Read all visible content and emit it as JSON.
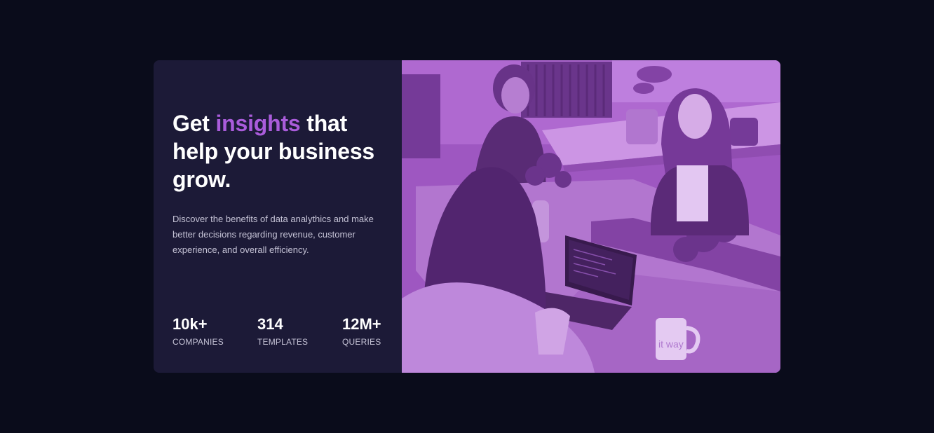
{
  "hero": {
    "title_before": "Get",
    "title_accent": "insights",
    "title_after": "that help your business grow.",
    "description": "Discover the benefits of data analythics and make better decisions regarding revenue, customer experience, and overall efficiency."
  },
  "stats": [
    {
      "value": "10k+",
      "label": "COMPANIES"
    },
    {
      "value": "314",
      "label": "TEMPLATES"
    },
    {
      "value": "12M+",
      "label": "QUERIES"
    }
  ],
  "image": {
    "mug_text": "it way"
  },
  "colors": {
    "page_background": "#0a0c1b",
    "card_background": "#1c1a37",
    "accent": "#aa5cdb",
    "image_overlay": "#aa5cdb"
  }
}
